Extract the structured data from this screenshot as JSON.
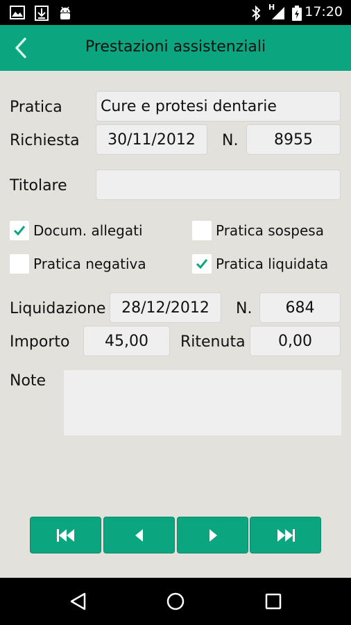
{
  "status": {
    "time": "17:20",
    "network_label": "H"
  },
  "app_bar": {
    "title": "Prestazioni assistenziali"
  },
  "form": {
    "pratica_label": "Pratica",
    "pratica_value": "Cure e protesi dentarie",
    "richiesta_label": "Richiesta",
    "richiesta_date": "30/11/2012",
    "richiesta_n_label": "N.",
    "richiesta_n_value": "8955",
    "titolare_label": "Titolare",
    "titolare_value": "",
    "checks": [
      {
        "label": "Docum. allegati",
        "checked": true
      },
      {
        "label": "Pratica sospesa",
        "checked": false
      },
      {
        "label": "Pratica negativa",
        "checked": false
      },
      {
        "label": "Pratica liquidata",
        "checked": true
      }
    ],
    "liquidazione_label": "Liquidazione",
    "liquidazione_date": "28/12/2012",
    "liquidazione_n_label": "N.",
    "liquidazione_n_value": "684",
    "importo_label": "Importo",
    "importo_value": "45,00",
    "ritenuta_label": "Ritenuta",
    "ritenuta_value": "0,00",
    "note_label": "Note",
    "note_value": ""
  },
  "navigation": {
    "first": "skip-to-first-icon",
    "prev": "previous-icon",
    "next": "next-icon",
    "last": "skip-to-last-icon"
  },
  "colors": {
    "accent": "#0ba680",
    "background": "#e2e1dc",
    "field": "#efefef"
  }
}
